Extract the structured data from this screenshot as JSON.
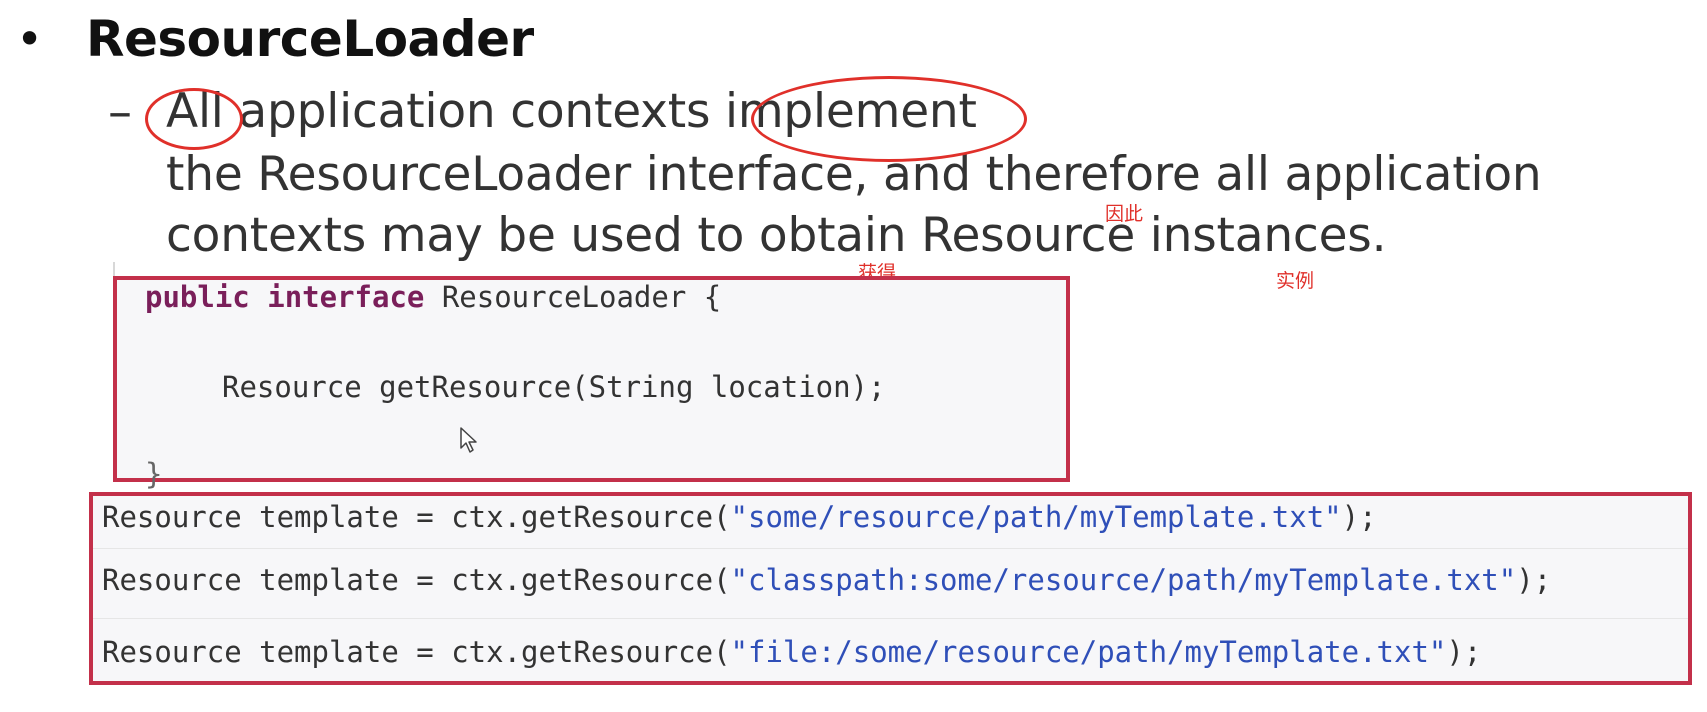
{
  "slide": {
    "bullet": "•",
    "heading": "ResourceLoader",
    "dash": "–",
    "line1_all": "All",
    "line1_mid": " application contexts ",
    "line1_implement": "implement",
    "line2": "the ResourceLoader interface, and therefore all application",
    "line3": "contexts may be used to obtain Resource instances."
  },
  "annotations": {
    "therefore": "因此",
    "obtain": "获得",
    "instances": "实例",
    "color": "#e0302a"
  },
  "code_box1": {
    "kw_public": "public",
    "kw_interface": "interface",
    "name": "ResourceLoader {",
    "method": "Resource getResource(String location);",
    "close": "}"
  },
  "code_box2": {
    "prefix": "Resource template = ctx.getResource(",
    "rows": [
      {
        "string": "\"some/resource/path/myTemplate.txt\"",
        "suffix": ");"
      },
      {
        "string": "\"classpath:some/resource/path/myTemplate.txt\"",
        "suffix": ");"
      },
      {
        "string": "\"file:/some/resource/path/myTemplate.txt\"",
        "suffix": ");"
      }
    ]
  },
  "colors": {
    "box_border": "#c3304a",
    "keyword": "#7a1f5a",
    "string": "#2f4fb8"
  },
  "icons": {
    "cursor": "mouse-pointer-icon"
  }
}
